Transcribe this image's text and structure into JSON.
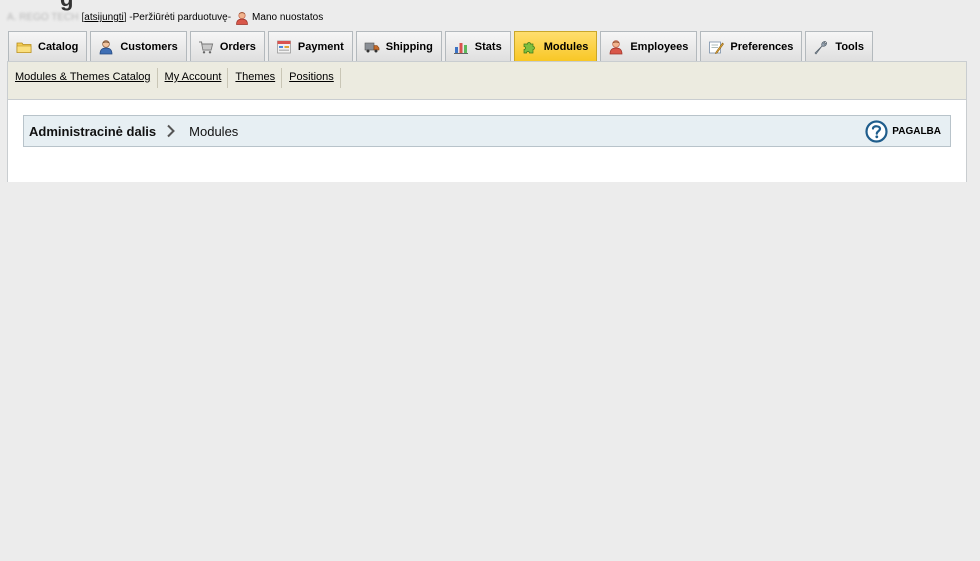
{
  "header": {
    "shop_name": "A. REGO TECH",
    "logout_open": "[ ",
    "logout_link": "atsijungti",
    "logout_close": " ] - ",
    "view_shop": "Peržiūrėti parduotuvę",
    "separator": " - ",
    "my_prefs": "Mano nuostatos"
  },
  "tabs": [
    {
      "label": "Catalog",
      "icon": "folder-icon"
    },
    {
      "label": "Customers",
      "icon": "customer-icon"
    },
    {
      "label": "Orders",
      "icon": "cart-icon"
    },
    {
      "label": "Payment",
      "icon": "payment-icon"
    },
    {
      "label": "Shipping",
      "icon": "truck-icon"
    },
    {
      "label": "Stats",
      "icon": "chart-icon"
    },
    {
      "label": "Modules",
      "icon": "puzzle-icon"
    },
    {
      "label": "Employees",
      "icon": "employee-icon"
    },
    {
      "label": "Preferences",
      "icon": "preferences-icon"
    },
    {
      "label": "Tools",
      "icon": "wrench-icon"
    }
  ],
  "active_tab": "Modules",
  "subnav": [
    "Modules & Themes Catalog",
    "My Account",
    "Themes",
    "Positions"
  ],
  "breadcrumb": {
    "root": "Administracinė dalis",
    "current": "Modules"
  },
  "help": {
    "label": "PAGALBA"
  },
  "colors": {
    "active_tab": "#f8c623",
    "subnav_bg": "#ecebe0",
    "breadcrumb_bg": "#e7eff3",
    "help_icon": "#1f5d8c"
  }
}
